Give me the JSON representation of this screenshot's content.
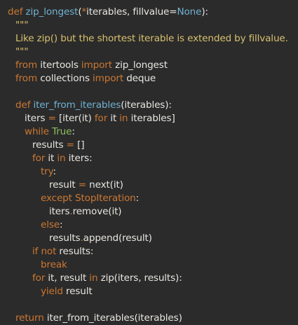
{
  "code": {
    "lines": [
      [
        {
          "t": "def ",
          "c": "kw"
        },
        {
          "t": "zip_longest",
          "c": "fn"
        },
        {
          "t": "(",
          "c": "plain"
        },
        {
          "t": "*",
          "c": "kw"
        },
        {
          "t": "iterables, fillvalue=",
          "c": "plain"
        },
        {
          "t": "None",
          "c": "fn"
        },
        {
          "t": "):",
          "c": "plain"
        }
      ],
      [
        {
          "t": "\"\"\"",
          "c": "doc"
        }
      ],
      [
        {
          "t": "Like zip() but the shortest iterable is extended by fillvalue.",
          "c": "doc"
        }
      ],
      [
        {
          "t": "\"\"\"",
          "c": "doc"
        }
      ],
      [
        {
          "t": "from ",
          "c": "kw"
        },
        {
          "t": "itertools ",
          "c": "plain"
        },
        {
          "t": "import ",
          "c": "kw"
        },
        {
          "t": "zip_longest",
          "c": "plain"
        }
      ],
      [
        {
          "t": "from ",
          "c": "kw"
        },
        {
          "t": "collections ",
          "c": "plain"
        },
        {
          "t": "import ",
          "c": "kw"
        },
        {
          "t": "deque",
          "c": "plain"
        }
      ],
      [],
      [
        {
          "t": "def ",
          "c": "kw"
        },
        {
          "t": "iter_from_iterables",
          "c": "fn"
        },
        {
          "t": "(iterables):",
          "c": "plain"
        }
      ],
      [
        {
          "t": "iters ",
          "c": "plain"
        },
        {
          "t": "= ",
          "c": "kw"
        },
        {
          "t": "[iter(it) ",
          "c": "plain"
        },
        {
          "t": "for ",
          "c": "kw"
        },
        {
          "t": "it ",
          "c": "plain"
        },
        {
          "t": "in ",
          "c": "kw"
        },
        {
          "t": "iterables]",
          "c": "plain"
        }
      ],
      [
        {
          "t": "while ",
          "c": "kw"
        },
        {
          "t": "True",
          "c": "def"
        },
        {
          "t": ":",
          "c": "plain"
        }
      ],
      [
        {
          "t": "results ",
          "c": "plain"
        },
        {
          "t": "= ",
          "c": "kw"
        },
        {
          "t": "[]",
          "c": "plain"
        }
      ],
      [
        {
          "t": "for ",
          "c": "kw"
        },
        {
          "t": "it ",
          "c": "plain"
        },
        {
          "t": "in ",
          "c": "kw"
        },
        {
          "t": "iters:",
          "c": "plain"
        }
      ],
      [
        {
          "t": "try",
          "c": "kw"
        },
        {
          "t": ":",
          "c": "plain"
        }
      ],
      [
        {
          "t": "result ",
          "c": "plain"
        },
        {
          "t": "= ",
          "c": "kw"
        },
        {
          "t": "next(it)",
          "c": "plain"
        }
      ],
      [
        {
          "t": "except ",
          "c": "kw"
        },
        {
          "t": "StopIteration",
          "c": "kw"
        },
        {
          "t": ":",
          "c": "plain"
        }
      ],
      [
        {
          "t": "iters",
          "c": "plain"
        },
        {
          "t": ".",
          "c": "kw"
        },
        {
          "t": "remove(it)",
          "c": "plain"
        }
      ],
      [
        {
          "t": "else",
          "c": "kw"
        },
        {
          "t": ":",
          "c": "plain"
        }
      ],
      [
        {
          "t": "results",
          "c": "plain"
        },
        {
          "t": ".",
          "c": "kw"
        },
        {
          "t": "append(result)",
          "c": "plain"
        }
      ],
      [
        {
          "t": "if ",
          "c": "kw"
        },
        {
          "t": "not ",
          "c": "kw"
        },
        {
          "t": "results:",
          "c": "plain"
        }
      ],
      [
        {
          "t": "break",
          "c": "kw"
        }
      ],
      [
        {
          "t": "for ",
          "c": "kw"
        },
        {
          "t": "it, result ",
          "c": "plain"
        },
        {
          "t": "in ",
          "c": "kw"
        },
        {
          "t": "zip(iters, results):",
          "c": "plain"
        }
      ],
      [
        {
          "t": "yield ",
          "c": "kw"
        },
        {
          "t": "result",
          "c": "plain"
        }
      ],
      [],
      [
        {
          "t": "return ",
          "c": "kw"
        },
        {
          "t": "iter_from_iterables(iterables)",
          "c": "plain"
        }
      ]
    ]
  },
  "colors": {
    "background": "#2b2b2b",
    "keyword": "#cc7832",
    "function": "#6fb3d2",
    "docstring": "#d7c06e",
    "builtin_constant": "#8fbf5f",
    "text": "#e8e6e1"
  }
}
